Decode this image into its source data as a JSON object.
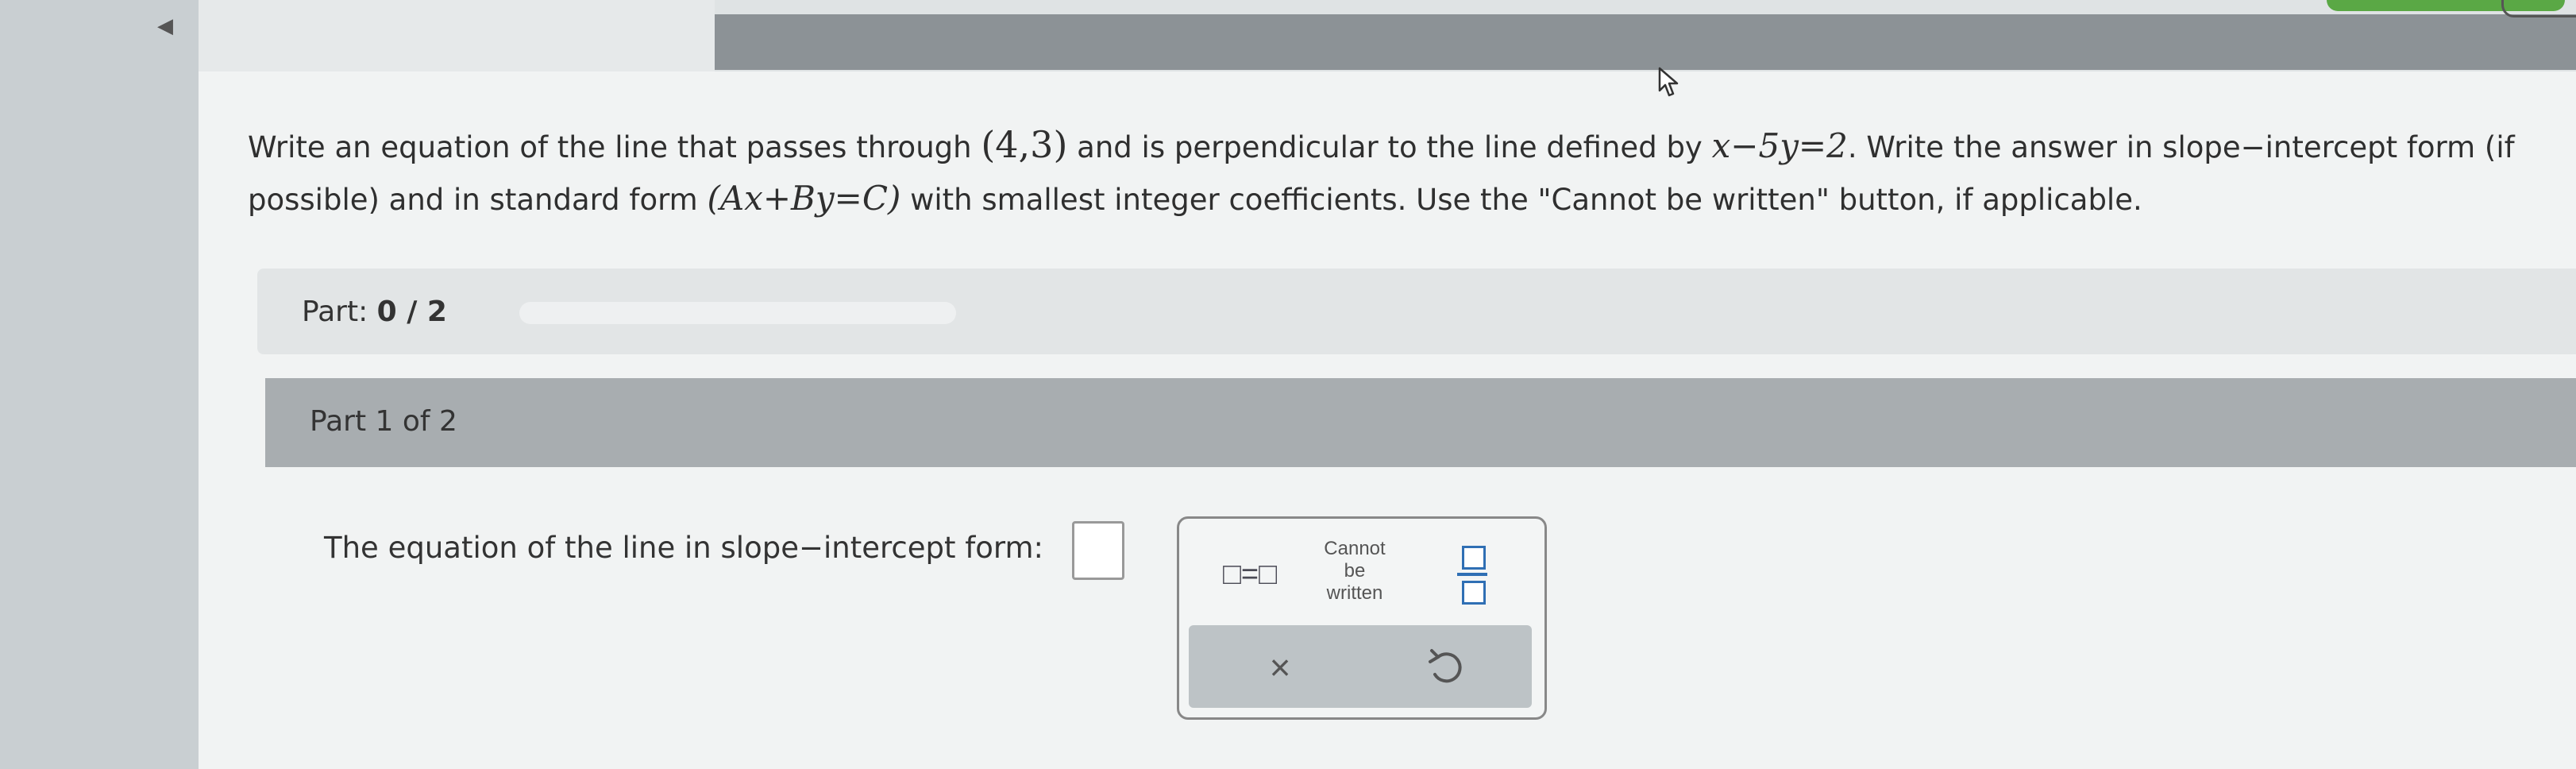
{
  "nav": {
    "back_icon": "back-arrow-icon"
  },
  "question": {
    "part1": "Write an equation of the line that passes through ",
    "point": "(4,3)",
    "part2": " and is perpendicular to the line defined by ",
    "line_eq": "x−5y=2",
    "part3": ". Write the answer in slope−intercept form (if possible) and in standard form ",
    "standard_form": "(Ax+By=C)",
    "part4": " with smallest integer coefficients. Use the \"Cannot be written\" button, if applicable."
  },
  "progress": {
    "label": "Part: ",
    "value": "0 / 2",
    "fraction": 0
  },
  "part": {
    "heading": "Part 1 of 2"
  },
  "answer": {
    "prompt": "The equation of the line in slope−intercept form:",
    "value": ""
  },
  "palette": {
    "equation_button": "□=□",
    "cannot_line1": "Cannot",
    "cannot_line2": "be",
    "cannot_line3": "written",
    "fraction_button_icon": "fraction-icon",
    "clear_button": "×",
    "undo_icon": "undo-icon"
  },
  "colors": {
    "accent_blue": "#2f6fb4",
    "green_button": "#5aa845"
  }
}
